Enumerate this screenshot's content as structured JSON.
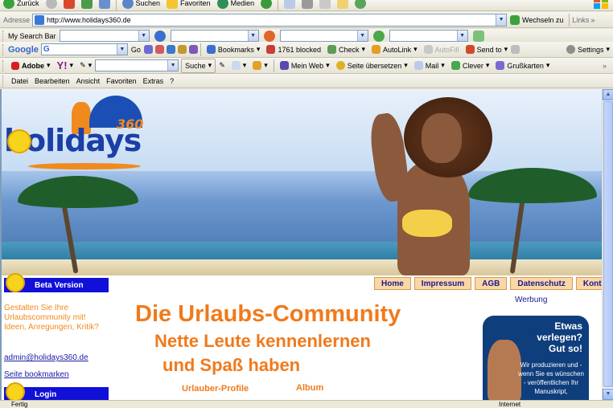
{
  "toolbar": {
    "back": "Zurück",
    "search": "Suchen",
    "favorites": "Favoriten",
    "media": "Medien"
  },
  "address": {
    "label": "Adresse",
    "url": "http://www.holidays360.de",
    "go": "Wechseln zu",
    "links": "Links"
  },
  "mysearch": {
    "label": "My Search Bar"
  },
  "google": {
    "label": "Google",
    "go": "Go",
    "bookmarks": "Bookmarks",
    "blocked": "1761 blocked",
    "check": "Check",
    "autolink": "AutoLink",
    "autofill": "AutoFill",
    "sendto": "Send to",
    "settings": "Settings"
  },
  "adobe": {
    "label": "Adobe",
    "suche": "Suche",
    "myweb": "Mein Web",
    "translate": "Seite übersetzen",
    "mail": "Mail",
    "clever": "Clever",
    "grusskarten": "Grußkarten"
  },
  "menu": [
    "Datei",
    "Bearbeiten",
    "Ansicht",
    "Favoriten",
    "Extras",
    "?"
  ],
  "site": {
    "logo_word": "holidays",
    "logo_num": "360",
    "nav": [
      "Home",
      "Impressum",
      "AGB",
      "Datenschutz",
      "Kontakt"
    ],
    "werbung": "Werbung",
    "beta_head": "Beta Version",
    "beta_text": "Gestalten Sie Ihre Urlaubscommunity mit! Ideen, Anregungen, Kritik?",
    "email": "admin@holidays360.de",
    "bookmark": "Seite bookmarken",
    "login_head": "Login",
    "title": "Die Urlaubs-Community",
    "sub1": "Nette Leute kennenlernen",
    "sub2": "und Spaß haben",
    "link_profiles": "Urlauber-Profile",
    "link_album": "Album",
    "ad_head1": "Etwas",
    "ad_head2": "verlegen?",
    "ad_head3": "Gut so!",
    "ad_text": "Wir produzieren und - wenn Sie es wünschen - veröffentlichen Ihr Manuskript,"
  },
  "status": {
    "left": "Fertig",
    "zone": "Internet"
  },
  "colors": {
    "accent_orange": "#f07a1c",
    "nav_bg": "#fbd7a6",
    "section_blue": "#1010d8",
    "link_blue": "#1a1aa6"
  }
}
